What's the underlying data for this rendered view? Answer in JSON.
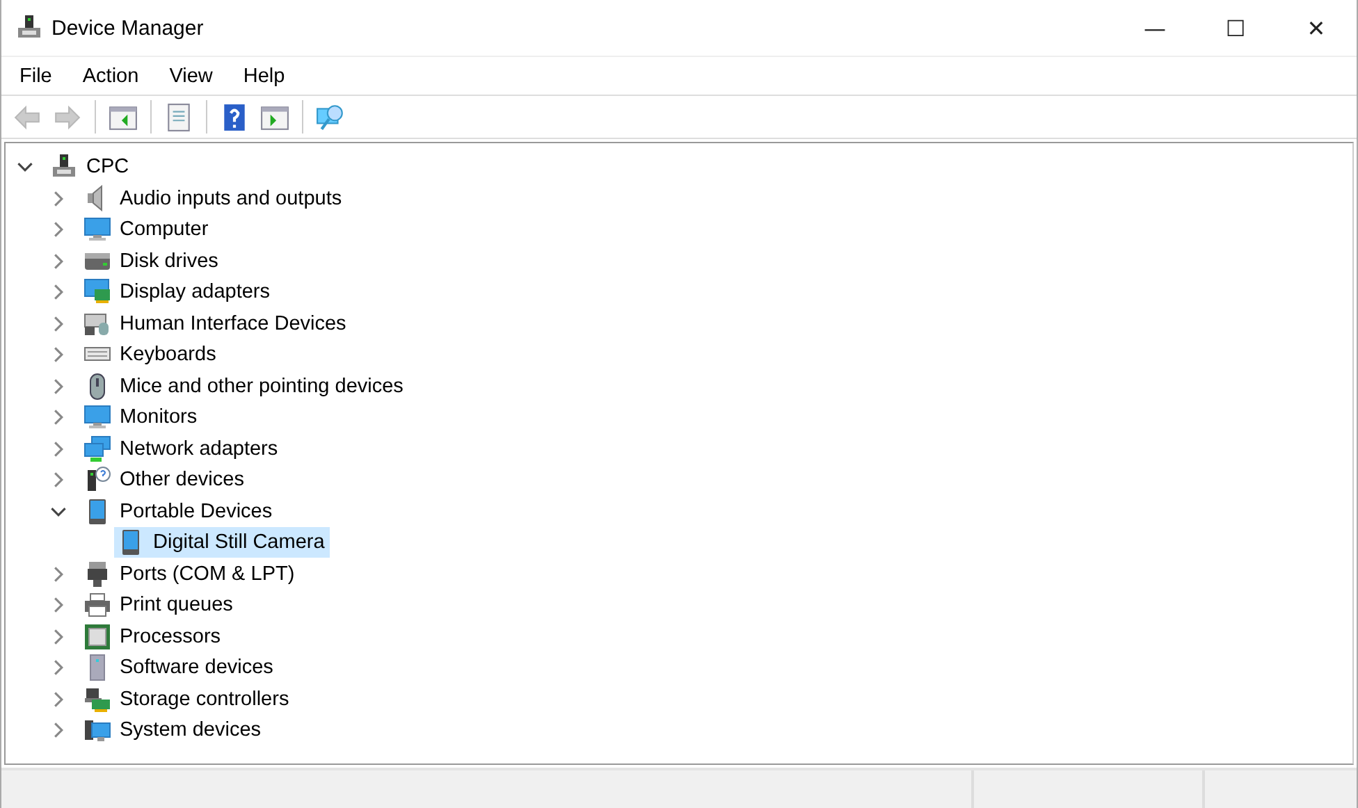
{
  "window": {
    "title": "Device Manager",
    "controls": [
      "—",
      "☐",
      "✕"
    ]
  },
  "menu": [
    "File",
    "Action",
    "View",
    "Help"
  ],
  "toolbar": [
    {
      "kind": "back",
      "disabled": true
    },
    {
      "kind": "forward",
      "disabled": true
    },
    {
      "kind": "sep"
    },
    {
      "kind": "console-tree"
    },
    {
      "kind": "sep"
    },
    {
      "kind": "properties"
    },
    {
      "kind": "sep"
    },
    {
      "kind": "help"
    },
    {
      "kind": "action-pane"
    },
    {
      "kind": "sep"
    },
    {
      "kind": "scan"
    }
  ],
  "tree": [
    {
      "label": "CPC",
      "kind": "computer-root",
      "expanded": true,
      "selected": false,
      "children": [
        {
          "label": "Audio inputs and outputs",
          "kind": "speaker",
          "expanded": false,
          "selected": false
        },
        {
          "label": "Computer",
          "kind": "monitor",
          "expanded": false,
          "selected": false
        },
        {
          "label": "Disk drives",
          "kind": "disk",
          "expanded": false,
          "selected": false
        },
        {
          "label": "Display adapters",
          "kind": "display-adapter",
          "expanded": false,
          "selected": false
        },
        {
          "label": "Human Interface Devices",
          "kind": "hid",
          "expanded": false,
          "selected": false
        },
        {
          "label": "Keyboards",
          "kind": "keyboard",
          "expanded": false,
          "selected": false
        },
        {
          "label": "Mice and other pointing devices",
          "kind": "mouse",
          "expanded": false,
          "selected": false
        },
        {
          "label": "Monitors",
          "kind": "monitor",
          "expanded": false,
          "selected": false
        },
        {
          "label": "Network adapters",
          "kind": "network",
          "expanded": false,
          "selected": false
        },
        {
          "label": "Other devices",
          "kind": "unknown",
          "expanded": false,
          "selected": false
        },
        {
          "label": "Portable Devices",
          "kind": "portable",
          "expanded": true,
          "selected": false,
          "children": [
            {
              "label": "Digital Still Camera",
              "kind": "portable",
              "selected": true
            }
          ]
        },
        {
          "label": "Ports (COM & LPT)",
          "kind": "port",
          "expanded": false,
          "selected": false
        },
        {
          "label": "Print queues",
          "kind": "printer",
          "expanded": false,
          "selected": false
        },
        {
          "label": "Processors",
          "kind": "chip",
          "expanded": false,
          "selected": false
        },
        {
          "label": "Software devices",
          "kind": "tower",
          "expanded": false,
          "selected": false
        },
        {
          "label": "Storage controllers",
          "kind": "storage",
          "expanded": false,
          "selected": false
        },
        {
          "label": "System devices",
          "kind": "system",
          "expanded": false,
          "selected": false
        }
      ]
    }
  ]
}
